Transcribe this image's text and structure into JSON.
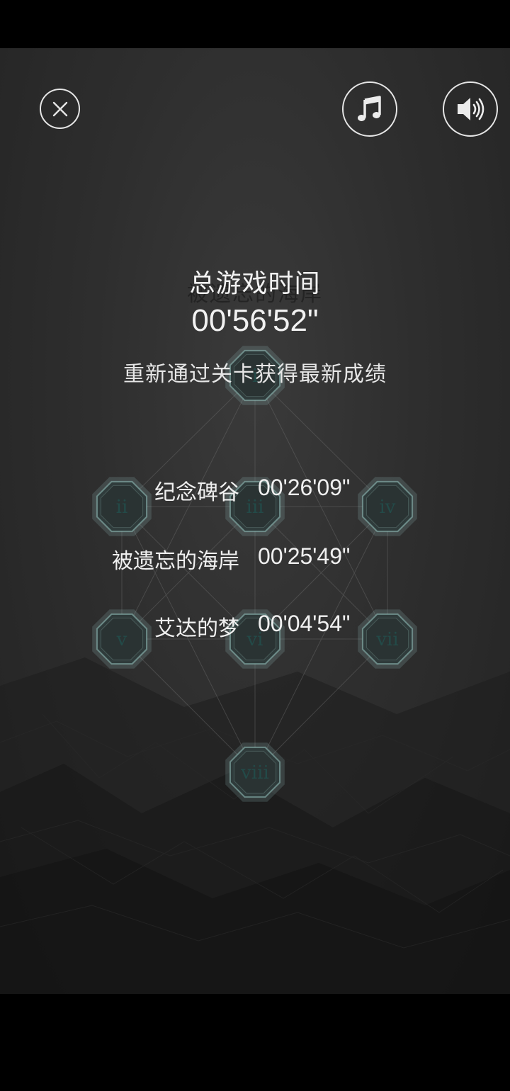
{
  "header": {
    "close_icon": "close-icon",
    "music_icon": "music-note-icon",
    "sound_icon": "speaker-icon"
  },
  "level_map": {
    "nodes": [
      "i",
      "ii",
      "iii",
      "iv",
      "v",
      "vi",
      "vii",
      "viii"
    ],
    "node_color": "#2f3b3b",
    "ring_color": "#9ecfcb",
    "label_color": "#234a48"
  },
  "summary": {
    "ghost_title": "被遗忘的海岸",
    "total_label": "总游戏时间",
    "total_time": "00'56'52\"",
    "hint": "重新通过关卡获得最新成绩"
  },
  "records": [
    {
      "name": "纪念碑谷",
      "time": "00'26'09\""
    },
    {
      "name": "被遗忘的海岸",
      "time": "00'25'49\""
    },
    {
      "name": "艾达的梦",
      "time": "00'04'54\""
    }
  ]
}
